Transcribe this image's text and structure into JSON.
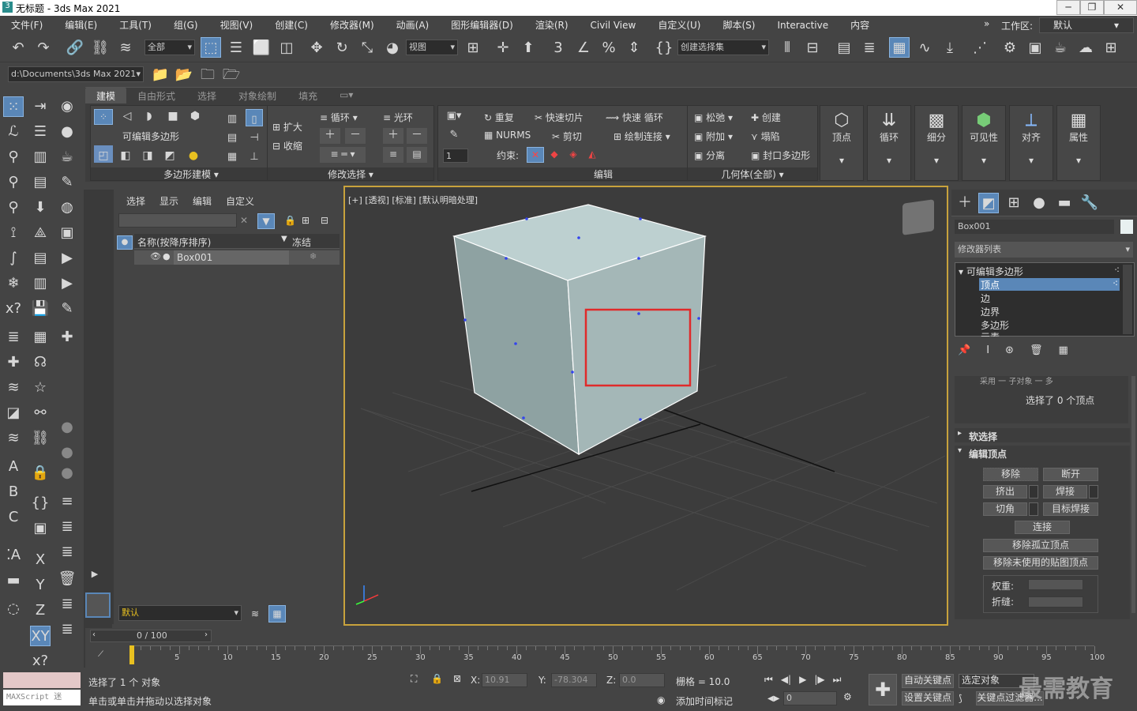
{
  "window": {
    "title": "无标题 - 3ds Max 2021"
  },
  "menu": [
    "文件(F)",
    "编辑(E)",
    "工具(T)",
    "组(G)",
    "视图(V)",
    "创建(C)",
    "修改器(M)",
    "动画(A)",
    "图形编辑器(D)",
    "渲染(R)",
    "Civil View",
    "自定义(U)",
    "脚本(S)",
    "Interactive",
    "内容"
  ],
  "workspace": {
    "label": "工作区:",
    "value": "默认"
  },
  "toolbar": {
    "filter_value": "全部",
    "coord_value": "视图",
    "selection_set": "创建选择集",
    "path_value": "d:\\Documents\\3ds Max 2021",
    "snap_3": "3"
  },
  "ribbon": {
    "tabs": [
      "建模",
      "自由形式",
      "选择",
      "对象绘制",
      "填充"
    ],
    "poly_modeling_label": "可编辑多边形",
    "panel_poly": "多边形建模",
    "panel_modsel": "修改选择",
    "panel_edit": "编辑",
    "panel_geom": "几何体(全部)",
    "expand": "扩大",
    "shrink": "收缩",
    "loop": "循环",
    "ring": "光环",
    "repeat": "重复",
    "quickslice": "快速切片",
    "quickloop": "快速 循环",
    "nurms": "NURMS",
    "cut": "剪切",
    "paintconnect": "绘制连接",
    "constraint": "约束:",
    "relax": "松弛",
    "create": "创建",
    "attach": "附加",
    "collapse": "塌陷",
    "detach": "分离",
    "cap": "封口多边形",
    "spinner_val": "1",
    "big_buttons": [
      "顶点",
      "循环",
      "细分",
      "可见性",
      "对齐",
      "属性"
    ]
  },
  "scene_explorer": {
    "tabs": [
      "选择",
      "显示",
      "编辑",
      "自定义"
    ],
    "col_name": "名称(按降序排序)",
    "col_freeze": "冻结",
    "object": "Box001",
    "layer": "默认"
  },
  "viewport": {
    "label": "[+] [透视] [标准] [默认明暗处理]"
  },
  "command_panel": {
    "object_name": "Box001",
    "modifier_list": "修改器列表",
    "stack": [
      "可编辑多边形",
      "顶点",
      "边",
      "边界",
      "多边形",
      "元素"
    ],
    "selected_info": "选择了 0 个顶点",
    "soft_sel": "软选择",
    "edit_vertices": "编辑顶点",
    "remove": "移除",
    "break": "断开",
    "extrude": "挤出",
    "weld": "焊接",
    "chamfer": "切角",
    "target_weld": "目标焊接",
    "connect": "连接",
    "remove_iso": "移除孤立顶点",
    "remove_unused": "移除未使用的贴图顶点",
    "weight": "权重:",
    "crease": "折缝:",
    "partial": "采用 一 子对象 一 多"
  },
  "timeline": {
    "frame": "0 / 100",
    "ticks": [
      "5",
      "10",
      "15",
      "20",
      "25",
      "30",
      "35",
      "40",
      "45",
      "50",
      "55",
      "60",
      "65",
      "70",
      "75",
      "80",
      "85",
      "90",
      "95",
      "100"
    ]
  },
  "status": {
    "selected": "选择了 1 个 对象",
    "prompt": "单击或单击并拖动以选择对象",
    "maxscript": "MAXScript 迷",
    "x_label": "X:",
    "x_val": "10.91",
    "y_label": "Y:",
    "y_val": "-78.304",
    "z_label": "Z:",
    "z_val": "0.0",
    "grid": "栅格 = 10.0",
    "add_time_tag": "添加时间标记",
    "auto_key": "自动关键点",
    "set_key": "设置关键点",
    "selected_obj": "选定对象",
    "key_filters": "关键点过滤器...",
    "frame_val": "0",
    "watermark": "最需教育"
  },
  "colors": {
    "accent": "#5a87b8",
    "viewport_border": "#c8a23c",
    "highlight_rect": "#e02a2a",
    "box_face": "#b4c8c8"
  }
}
